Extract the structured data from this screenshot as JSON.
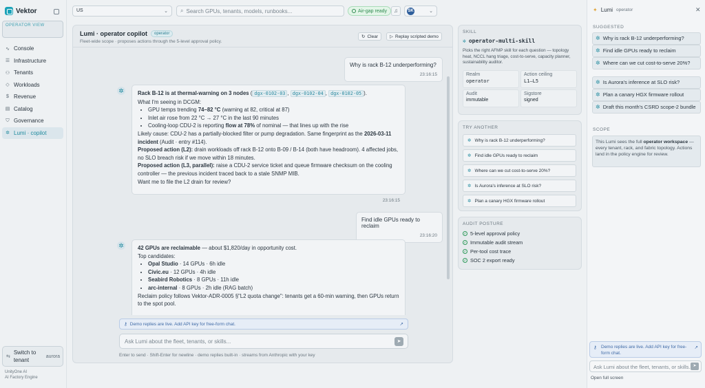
{
  "app": {
    "name": "Vektor",
    "operator_view": "OPERATOR VIEW"
  },
  "sidebar": {
    "items": [
      {
        "label": "Console",
        "icon": "pulse-icon"
      },
      {
        "label": "Infrastructure",
        "icon": "server-icon"
      },
      {
        "label": "Tenants",
        "icon": "users-icon"
      },
      {
        "label": "Workloads",
        "icon": "workloads-icon"
      },
      {
        "label": "Revenue",
        "icon": "dollar-icon"
      },
      {
        "label": "Catalog",
        "icon": "catalog-icon"
      },
      {
        "label": "Governance",
        "icon": "shield-icon"
      },
      {
        "label": "Lumi · copilot",
        "icon": "sparkle-icon"
      }
    ],
    "switch_tenant": {
      "label": "Switch to tenant",
      "value": "aurora"
    },
    "footer": {
      "line1": "UnityOne AI",
      "line2": "AI Factory Engine"
    }
  },
  "topbar": {
    "region": "US",
    "search_placeholder": "Search GPUs, tenants, models, runbooks...",
    "airgap": "Air-gap ready",
    "user_initials": "SK"
  },
  "chat": {
    "title": "Lumi · operator copilot",
    "badge": "operator",
    "subtitle": "Fleet-wide scope · proposes actions through the 5-level approval policy.",
    "clear": "Clear",
    "replay": "Replay scripted demo",
    "m1": {
      "text": "Why is rack B-12 underperforming?",
      "time": "23:16:15"
    },
    "a1": {
      "lead": "Rack B-12 is at thermal-warning on 3 nodes",
      "codes": [
        "dgx-0102-03",
        "dgx-0102-04",
        "dgx-0102-05"
      ],
      "intro": "What I'm seeing in DCGM:",
      "b1_pre": "GPU temps trending ",
      "b1_bold": "74–82 °C",
      "b1_post": " (warning at 82, critical at 87)",
      "b2": "Inlet air rose from 22 °C → 27 °C in the last 90 minutes",
      "b3_pre": "Cooling-loop CDU-2 is reporting ",
      "b3_bold": "flow at 78%",
      "b3_post": " of nominal — that lines up with the rise",
      "cause_pre": "Likely cause: CDU-2 has a partially-blocked filter or pump degradation. Same fingerprint as the ",
      "cause_bold": "2026-03-11 incident",
      "cause_post": " (Audit · entry #114).",
      "p1_bold": "Proposed action (L2):",
      "p1_text": " drain workloads off rack B-12 onto B-09 / B-14 (both have headroom). 4 affected jobs, no SLO breach risk if we move within 18 minutes.",
      "p2_bold": "Proposed action (L3, parallel):",
      "p2_text": " raise a CDU-2 service ticket and queue firmware checksum on the cooling controller — the previous incident traced back to a stale SNMP MIB.",
      "ask": "Want me to file the L2 drain for review?",
      "time": "23:16:15"
    },
    "m2": {
      "text": "Find idle GPUs ready to reclaim",
      "time": "23:16:20"
    },
    "a2": {
      "lead_bold": "42 GPUs are reclaimable",
      "lead_rest": " — about $1,820/day in opportunity cost.",
      "top": "Top candidates:",
      "rows": [
        {
          "name": "Opal Studio",
          "detail": " · 14 GPUs · 6h idle"
        },
        {
          "name": "Civic.eu",
          "detail": " · 12 GPUs · 4h idle"
        },
        {
          "name": "Seabird Robotics",
          "detail": " · 8 GPUs · 11h idle"
        },
        {
          "name": "arc-internal",
          "detail": " · 8 GPUs · 2h idle (RAG batch)"
        }
      ],
      "policy": "Reclaim policy follows Vektor-ADR-0005 §\"L2 quota change\": tenants get a 60-min warning, then GPUs return to the spot pool."
    },
    "demo_notice": "Demo replies are live. Add API key for free-form chat.",
    "input_placeholder": "Ask Lumi about the fleet, tenants, or skills...",
    "hint": "Enter to send · Shift-Enter for newline · demo replies built-in · streams from Anthropic with your key"
  },
  "skill": {
    "caption": "SKILL",
    "name": "operator-multi-skill",
    "desc": "Picks the right AFMP skill for each question — topology heat, NCCL hang triage, cost-to-serve, capacity planner, sustainability auditor.",
    "realm_k": "Realm",
    "realm_v": "operator",
    "ceiling_k": "Action ceiling",
    "ceiling_v": "L1–L5",
    "audit_k": "Audit",
    "audit_v": "immutable",
    "sigstore_k": "Sigstore",
    "sigstore_v": "signed"
  },
  "try_another": {
    "caption": "TRY ANOTHER",
    "items": [
      "Why is rack B-12 underperforming?",
      "Find idle GPUs ready to reclaim",
      "Where can we cut cost-to-serve 20%?",
      "Is Aurora's inference at SLO risk?",
      "Plan a canary HGX firmware rollout"
    ]
  },
  "audit_posture": {
    "caption": "AUDIT POSTURE",
    "items": [
      "5-level approval policy",
      "Immutable audit stream",
      "Per-tool cost trace",
      "SOC 2 export ready"
    ]
  },
  "lumi": {
    "title": "Lumi",
    "role": "operator",
    "suggested_caption": "SUGGESTED",
    "suggested": [
      "Why is rack B-12 underperforming?",
      "Find idle GPUs ready to reclaim",
      "Where can we cut cost-to-serve 20%?",
      "Is Aurora's inference at SLO risk?",
      "Plan a canary HGX firmware rollout",
      "Draft this month's CSRD scope-2 bundle"
    ],
    "scope_caption": "SCOPE",
    "scope_pre": "This Lumi sees the full ",
    "scope_bold": "operator workspace",
    "scope_post": " — every tenant, rack, and fabric topology. Actions land in the policy engine for review.",
    "demo_notice": "Demo replies are live. Add API key for free-form chat.",
    "input_placeholder": "Ask Lumi about the fleet, tenants, or skills...",
    "open_full": "Open full screen"
  },
  "colors": {
    "accent": "#1f8a9e",
    "success": "#2e9a5a",
    "info": "#3f6aa6"
  }
}
